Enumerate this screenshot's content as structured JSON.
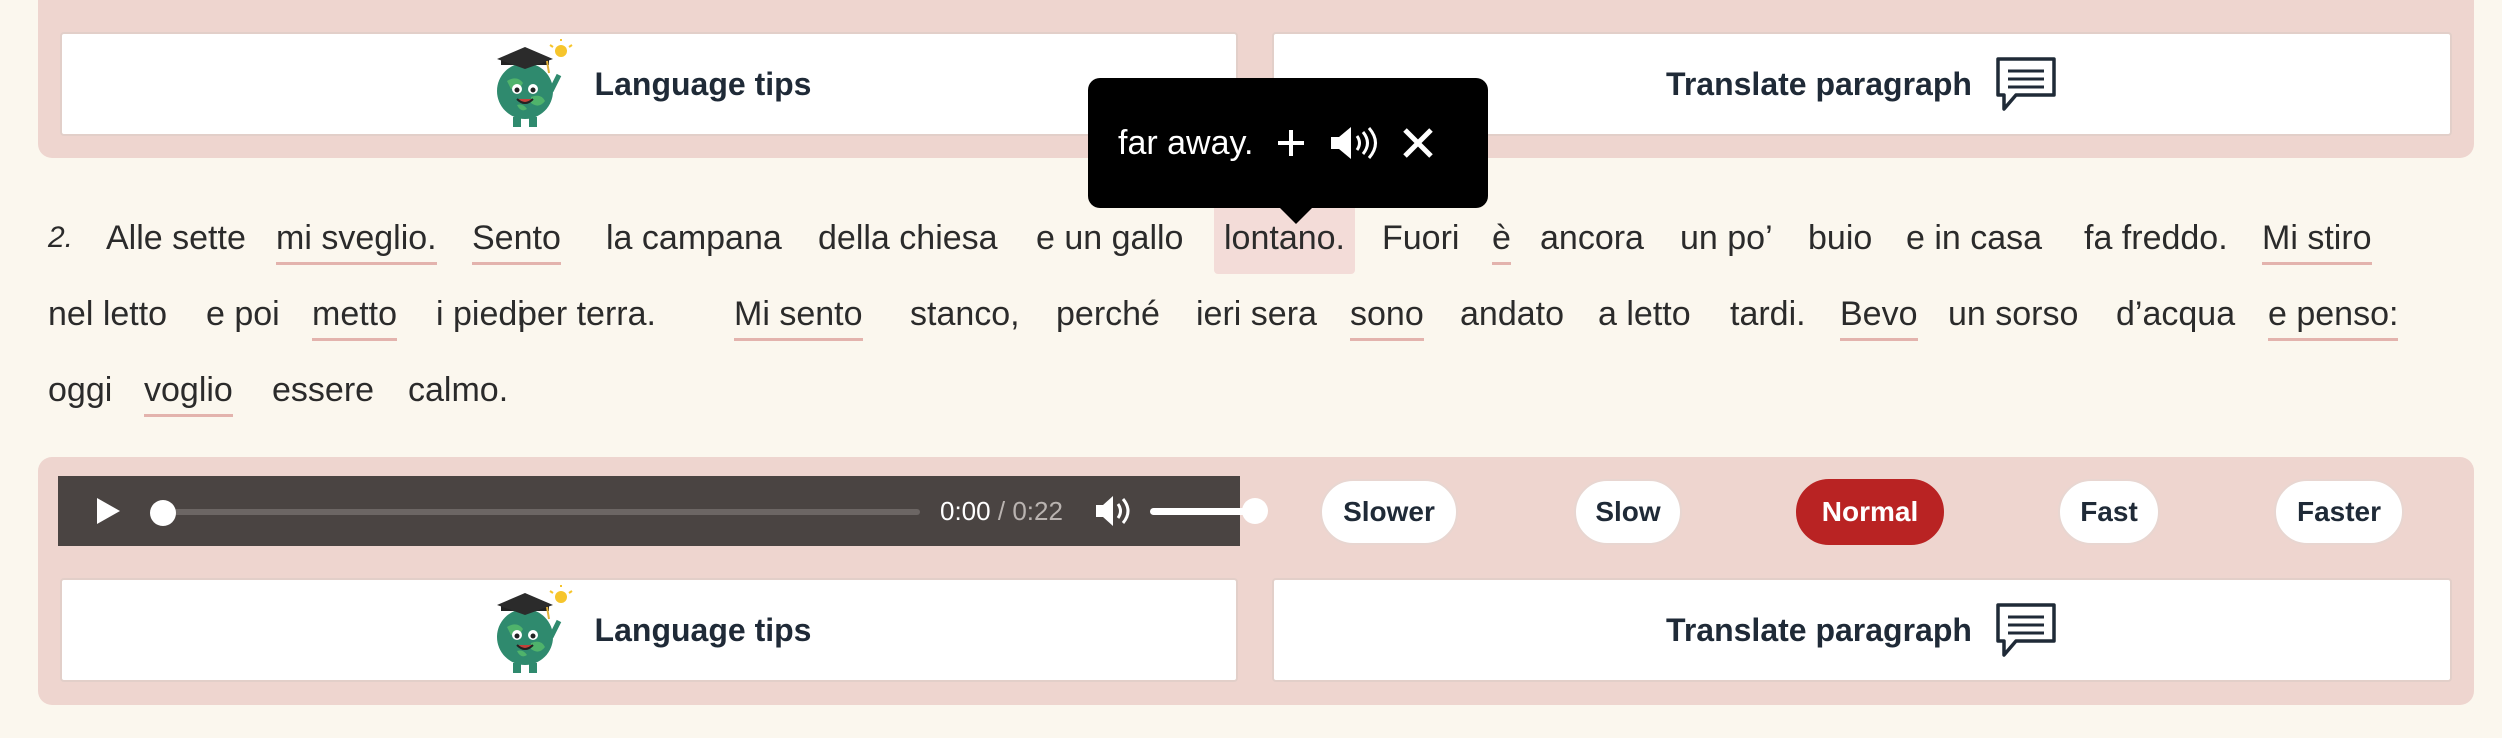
{
  "actions": {
    "language_tips": "Language tips",
    "translate_paragraph": "Translate paragraph"
  },
  "tooltip": {
    "translation": "far away."
  },
  "paragraph": {
    "number": "2.",
    "lines": [
      [
        {
          "text": "Alle sette"
        },
        {
          "text": "mi sveglio.",
          "underline": true
        },
        {
          "text": "Sento",
          "underline": true
        },
        {
          "text": "la campana"
        },
        {
          "text": "della chiesa"
        },
        {
          "text": "e un gallo"
        },
        {
          "text": "lontano.",
          "active": true
        },
        {
          "text": "Fuori"
        },
        {
          "text": "è",
          "underline": true
        },
        {
          "text": "ancora"
        },
        {
          "text": "un po’"
        },
        {
          "text": "buio"
        },
        {
          "text": "e in casa"
        },
        {
          "text": "fa freddo."
        },
        {
          "text": "Mi stiro",
          "underline": true
        }
      ],
      [
        {
          "text": "nel letto"
        },
        {
          "text": "e poi"
        },
        {
          "text": "metto",
          "underline": true
        },
        {
          "text": "i piedi"
        },
        {
          "text": "per terra."
        },
        {
          "text": "Mi sento",
          "underline": true
        },
        {
          "text": "stanco,"
        },
        {
          "text": "perché"
        },
        {
          "text": "ieri sera"
        },
        {
          "text": "sono",
          "underline": true
        },
        {
          "text": "andato"
        },
        {
          "text": "a letto"
        },
        {
          "text": "tardi."
        },
        {
          "text": "Bevo",
          "underline": true
        },
        {
          "text": "un sorso"
        },
        {
          "text": "d’acqua"
        },
        {
          "text": "e penso:",
          "underline": true
        }
      ],
      [
        {
          "text": "oggi"
        },
        {
          "text": "voglio",
          "underline": true
        },
        {
          "text": "essere"
        },
        {
          "text": "calmo."
        }
      ]
    ]
  },
  "player": {
    "current_time": "0:00",
    "separator": "/",
    "duration": "0:22",
    "progress": 0,
    "volume": 1.0
  },
  "speeds": {
    "options": [
      "Slower",
      "Slow",
      "Normal",
      "Fast",
      "Faster"
    ],
    "selected": "Normal"
  },
  "colors": {
    "panel": "#eed5cf",
    "underline": "#e3b3ad",
    "accent": "#b92323",
    "highlight": "#f3dcd8",
    "player_bg": "#4a4442"
  }
}
